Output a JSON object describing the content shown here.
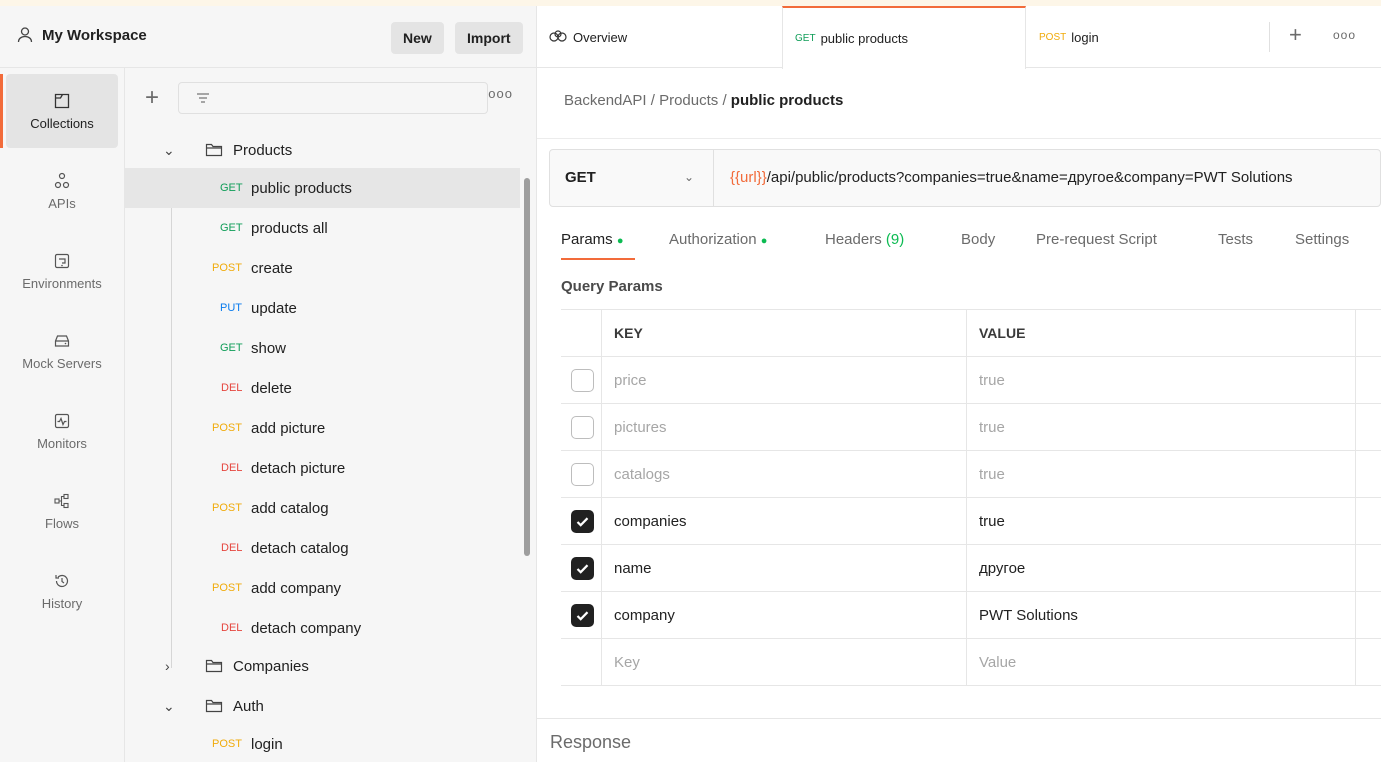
{
  "workspace": {
    "title": "My Workspace",
    "new_label": "New",
    "import_label": "Import"
  },
  "nav": [
    {
      "label": "Collections",
      "icon": "collections-icon",
      "active": true
    },
    {
      "label": "APIs",
      "icon": "apis-icon"
    },
    {
      "label": "Environments",
      "icon": "environments-icon"
    },
    {
      "label": "Mock Servers",
      "icon": "mock-servers-icon"
    },
    {
      "label": "Monitors",
      "icon": "monitors-icon"
    },
    {
      "label": "Flows",
      "icon": "flows-icon"
    },
    {
      "label": "History",
      "icon": "history-icon"
    }
  ],
  "tree": {
    "products_folder": "Products",
    "companies_folder": "Companies",
    "auth_folder": "Auth",
    "requests": [
      {
        "method": "GET",
        "name": "public products"
      },
      {
        "method": "GET",
        "name": "products all"
      },
      {
        "method": "POST",
        "name": "create"
      },
      {
        "method": "PUT",
        "name": "update"
      },
      {
        "method": "GET",
        "name": "show"
      },
      {
        "method": "DEL",
        "name": "delete"
      },
      {
        "method": "POST",
        "name": "add picture"
      },
      {
        "method": "DEL",
        "name": "detach picture"
      },
      {
        "method": "POST",
        "name": "add catalog"
      },
      {
        "method": "DEL",
        "name": "detach catalog"
      },
      {
        "method": "POST",
        "name": "add company"
      },
      {
        "method": "DEL",
        "name": "detach company"
      }
    ],
    "auth_requests": [
      {
        "method": "POST",
        "name": "login"
      }
    ]
  },
  "tabs": {
    "overview": "Overview",
    "tab1_method": "GET",
    "tab1_name": "public products",
    "tab2_method": "POST",
    "tab2_name": "login"
  },
  "breadcrumb": {
    "part1": "BackendAPI",
    "sep1": "/",
    "part2": "Products",
    "sep2": "/",
    "current": "public products"
  },
  "request": {
    "method": "GET",
    "url_var": "{{url}}",
    "url_rest": "/api/public/products?companies=true&name=другое&company=PWT Solutions"
  },
  "request_tabs": {
    "params": "Params",
    "authorization": "Authorization",
    "headers": "Headers",
    "headers_count": "(9)",
    "body": "Body",
    "prerequest": "Pre-request Script",
    "tests": "Tests",
    "settings": "Settings",
    "dot": "●"
  },
  "query_params": {
    "title": "Query Params",
    "key_header": "KEY",
    "value_header": "VALUE",
    "rows": [
      {
        "key": "price",
        "value": "true",
        "checked": false
      },
      {
        "key": "pictures",
        "value": "true",
        "checked": false
      },
      {
        "key": "catalogs",
        "value": "true",
        "checked": false
      },
      {
        "key": "companies",
        "value": "true",
        "checked": true
      },
      {
        "key": "name",
        "value": "другое",
        "checked": true
      },
      {
        "key": "company",
        "value": "PWT Solutions",
        "checked": true
      }
    ],
    "key_placeholder": "Key",
    "value_placeholder": "Value"
  },
  "response": {
    "label": "Response"
  },
  "colors": {
    "accent": "#f26b3a",
    "get": "#0f9d58",
    "post": "#f0ab0b",
    "put": "#097bed",
    "del": "#e5453e",
    "dot_green": "#0cbb52"
  }
}
